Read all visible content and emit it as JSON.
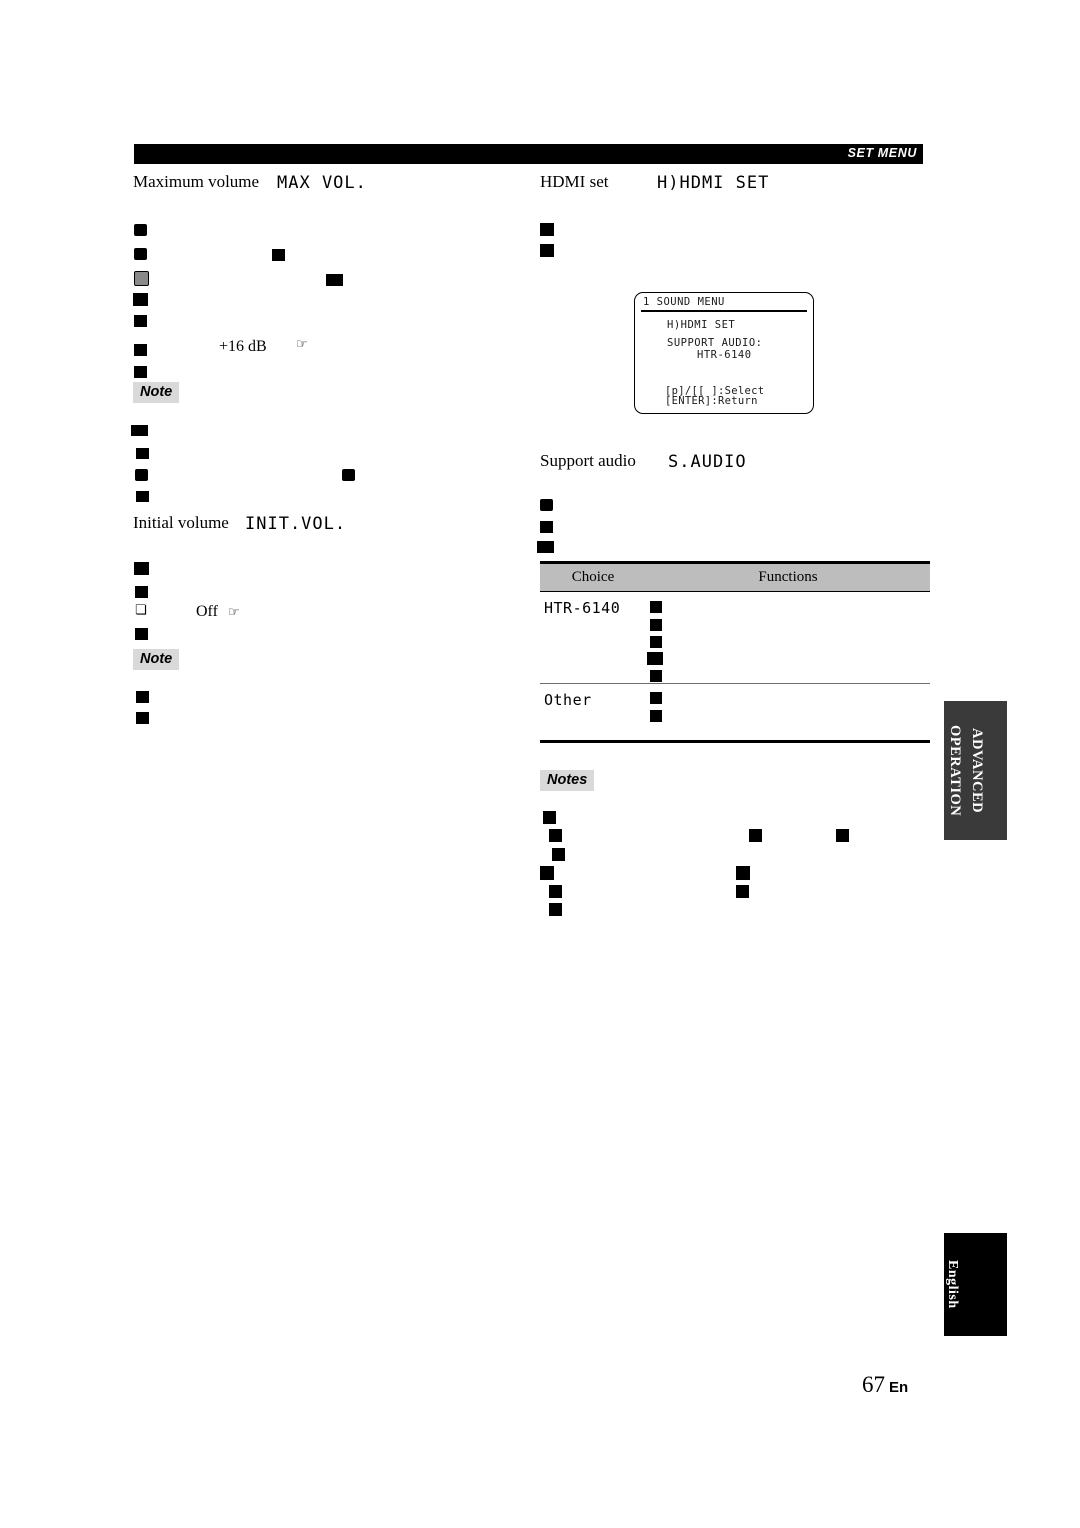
{
  "page": {
    "folio_number": "67",
    "folio_lang": "En",
    "header_label": "SET MENU"
  },
  "tabs": {
    "advanced": "ADVANCED\nOPERATION",
    "advanced_line1": "ADVANCED",
    "advanced_line2": "OPERATION",
    "language": "English"
  },
  "left_column": {
    "sections": [
      {
        "title_en": "Maximum volume",
        "title_lcd": "MAX VOL.",
        "inline_value": "+16 dB",
        "inline_icon": "☞"
      },
      {
        "title_en": "Initial volume",
        "title_lcd": "INIT.VOL.",
        "option_label": "Off",
        "option_icon": "☞",
        "option_bullet": "❏"
      }
    ],
    "note_badges": [
      "Note",
      "Note"
    ]
  },
  "right_column": {
    "sections": [
      {
        "title_en": "HDMI set",
        "title_lcd": "H)HDMI SET"
      },
      {
        "title_en": "Support audio",
        "title_lcd": "S.AUDIO"
      }
    ],
    "display": {
      "title": "1 SOUND MENU",
      "line1": "H)HDMI SET",
      "line2": "SUPPORT AUDIO:",
      "line3": "HTR-6140",
      "footer1": "[p]/[[ ]:Select",
      "footer2": "[ENTER]:Return"
    },
    "table": {
      "headers": [
        "Choice",
        "Functions"
      ],
      "rows": [
        {
          "choice": "HTR-6140",
          "function_lines": 5
        },
        {
          "choice": "Other",
          "function_lines": 2
        }
      ]
    },
    "notes_badge": "Notes"
  },
  "colors": {
    "header_bar": "#000000",
    "note_badge_bg": "#d9d9d9",
    "table_head_bg": "#bdbdbd",
    "tab_advanced_bg": "#3a3a3a",
    "tab_language_bg": "#000000",
    "redaction": "#000000"
  }
}
